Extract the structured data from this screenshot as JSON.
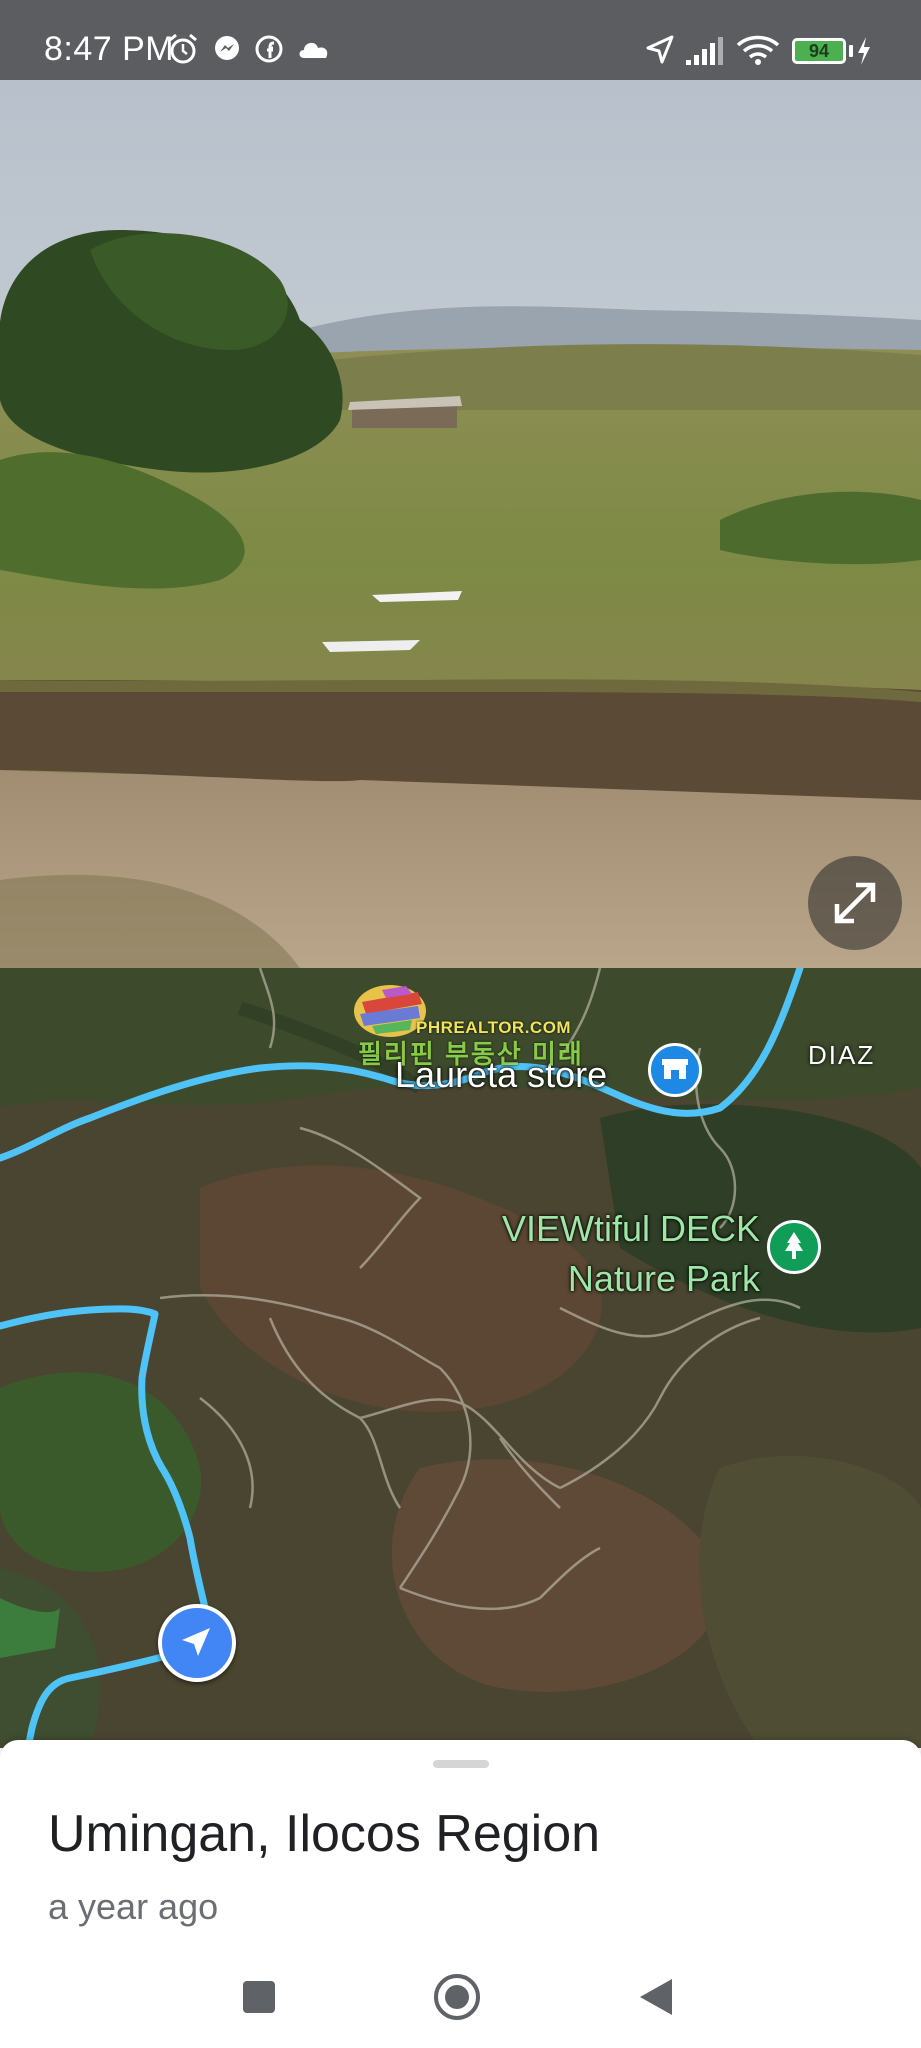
{
  "status_bar": {
    "time": "8:47 PM",
    "battery_level": "94",
    "icons": [
      "alarm-icon",
      "messenger-icon",
      "facebook-icon",
      "cloud-icon",
      "location-arrow-icon",
      "signal-icon",
      "wifi-icon",
      "battery-icon",
      "charging-icon"
    ]
  },
  "street_view": {
    "expand_icon": "expand-icon"
  },
  "map": {
    "labels": {
      "store": "Laureta store",
      "area": "DIAZ",
      "park_line1": "VIEWtiful DECK",
      "park_line2": "Nature Park"
    },
    "watermark": {
      "domain": "PHREALTOR.COM",
      "korean": "필리핀 부동산 미래"
    },
    "route_color": "#4fc3f7",
    "pin_icons": [
      "store-icon",
      "tree-icon"
    ],
    "marker_icon": "navigation-arrow-icon"
  },
  "sheet": {
    "title": "Umingan, Ilocos Region",
    "subtitle": "a year ago"
  },
  "nav": {
    "icons": [
      "recents-square-icon",
      "home-circle-icon",
      "back-triangle-icon"
    ]
  }
}
